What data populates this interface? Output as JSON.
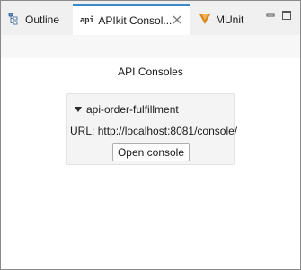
{
  "tabs": [
    {
      "label": "Outline",
      "icon": "outline-icon"
    },
    {
      "label": "APIkit Consol...",
      "icon": "api-icon",
      "icon_text": "api",
      "active": true
    },
    {
      "label": "MUnit",
      "icon": "munit-icon"
    }
  ],
  "window_controls": {
    "minimize": "minimize-icon",
    "maximize": "maximize-icon"
  },
  "main": {
    "title": "API Consoles",
    "apis": [
      {
        "name": "api-order-fulfillment",
        "url_label": "URL:",
        "url": "http://localhost:8081/console/",
        "button_label": "Open console"
      }
    ]
  },
  "colors": {
    "active_tab_accent": "#3a8ac8",
    "munit_icon": "#d98b1e"
  }
}
